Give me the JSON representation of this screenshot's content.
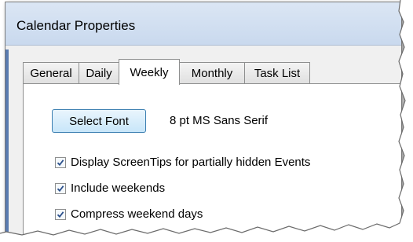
{
  "window": {
    "title": "Calendar Properties"
  },
  "tabs": [
    {
      "label": "General",
      "active": false
    },
    {
      "label": "Daily",
      "active": false
    },
    {
      "label": "Weekly",
      "active": true
    },
    {
      "label": "Monthly",
      "active": false
    },
    {
      "label": "Task List",
      "active": false
    }
  ],
  "weekly": {
    "select_font_label": "Select Font",
    "font_info": "8 pt MS Sans Serif",
    "options": [
      {
        "label": "Display ScreenTips for partially hidden Events",
        "checked": true
      },
      {
        "label": "Include weekends",
        "checked": true
      },
      {
        "label": "Compress weekend days",
        "checked": true
      }
    ]
  },
  "colors": {
    "titlebar": "#dbe6f4",
    "button_border": "#3c7fb1",
    "checkmark": "#2a4f8a"
  }
}
